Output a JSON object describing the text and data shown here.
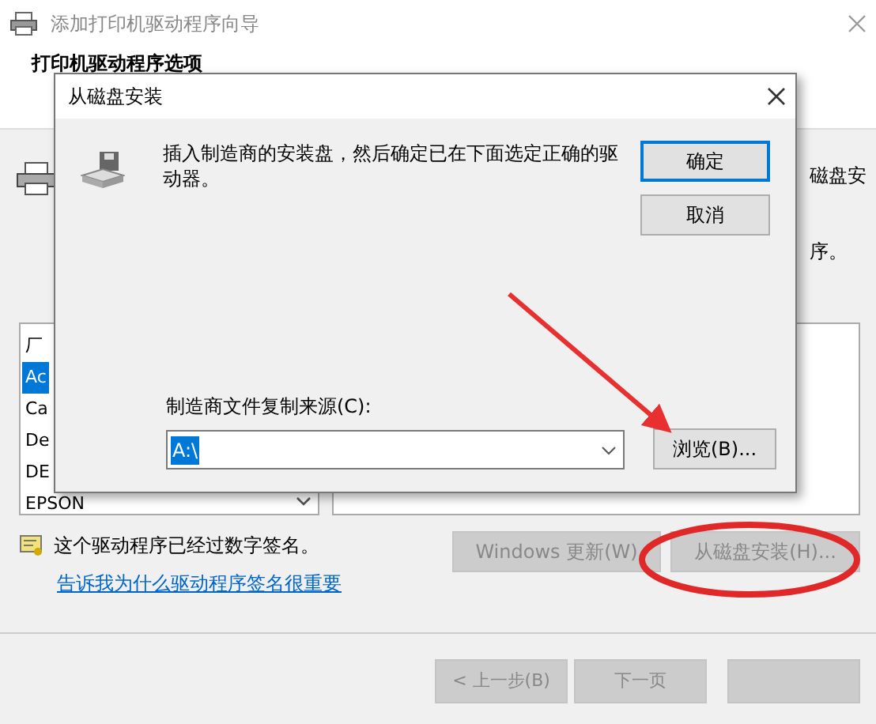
{
  "wizard": {
    "title": "添加打印机驱动程序向导",
    "heading": "打印机驱动程序选项",
    "side_text": [
      "磁盘安",
      "序。"
    ],
    "list_header": "厂",
    "manufacturers": [
      {
        "label": "Ac",
        "selected": true
      },
      {
        "label": "Ca",
        "selected": false
      },
      {
        "label": "De",
        "selected": false
      },
      {
        "label": "DE",
        "selected": false
      },
      {
        "label": "EPSON",
        "selected": false
      }
    ],
    "signed_note": "这个驱动程序已经过数字签名。",
    "link": "告诉我为什么驱动程序签名很重要",
    "action_buttons": [
      {
        "label": "Windows 更新(W)",
        "disabled": true
      },
      {
        "label": "从磁盘安装(H)...",
        "disabled": true
      }
    ],
    "nav_buttons": [
      {
        "label": "< 上一步(B)",
        "disabled": true
      },
      {
        "label": "下一页",
        "disabled": true
      },
      {
        "disabled": true
      }
    ]
  },
  "dialog": {
    "title": "从磁盘安装",
    "message": "插入制造商的安装盘，然后确定已在下面选定正确的驱动器。",
    "buttons": [
      {
        "label": "确定",
        "focused": true
      },
      {
        "label": "取消",
        "focused": false
      }
    ],
    "source_label": "制造商文件复制来源(C):",
    "source_value": "A:\\",
    "browse": "浏览(B)..."
  }
}
